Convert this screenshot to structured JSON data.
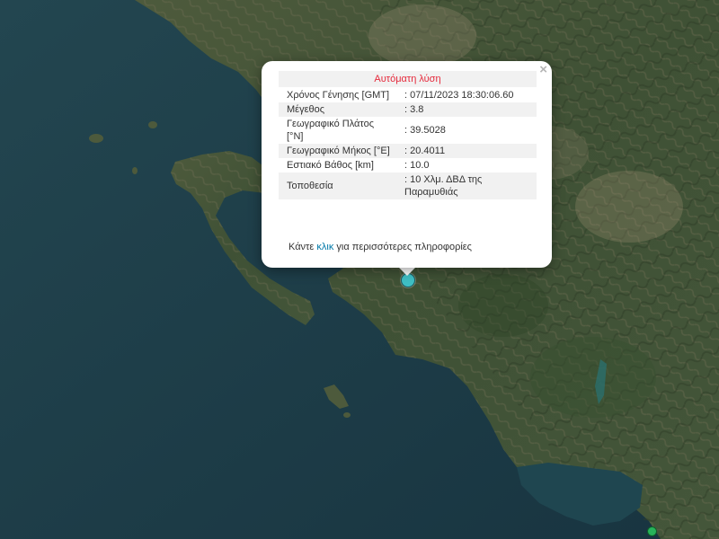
{
  "popup": {
    "title": "Αυτόματη λύση",
    "close_symbol": "×",
    "rows": [
      {
        "label": "Χρόνος Γένησης [GMT]",
        "value": ": 07/11/2023 18:30:06.60"
      },
      {
        "label": "Μέγεθος",
        "value": ": 3.8"
      },
      {
        "label": "Γεωγραφικό Πλάτος [°N]",
        "value": ": 39.5028"
      },
      {
        "label": "Γεωγραφικό Μήκος [°E]",
        "value": ": 20.4011"
      },
      {
        "label": "Εστιακό Βάθος [km]",
        "value": ": 10.0"
      },
      {
        "label": "Τοποθεσία",
        "value": ": 10 Χλμ. ΔΒΔ της Παραμυθιάς"
      }
    ],
    "more_prefix": "Κάντε ",
    "more_link": "κλικ",
    "more_suffix": " για περισσότερες πληροφορίες"
  },
  "colors": {
    "title_red": "#e6293b",
    "link_blue": "#0078a8",
    "marker_main": "#3fbfc4",
    "marker_secondary": "#27b35a",
    "sea": "#1d3a44"
  },
  "icons": {
    "close": "close-icon"
  }
}
